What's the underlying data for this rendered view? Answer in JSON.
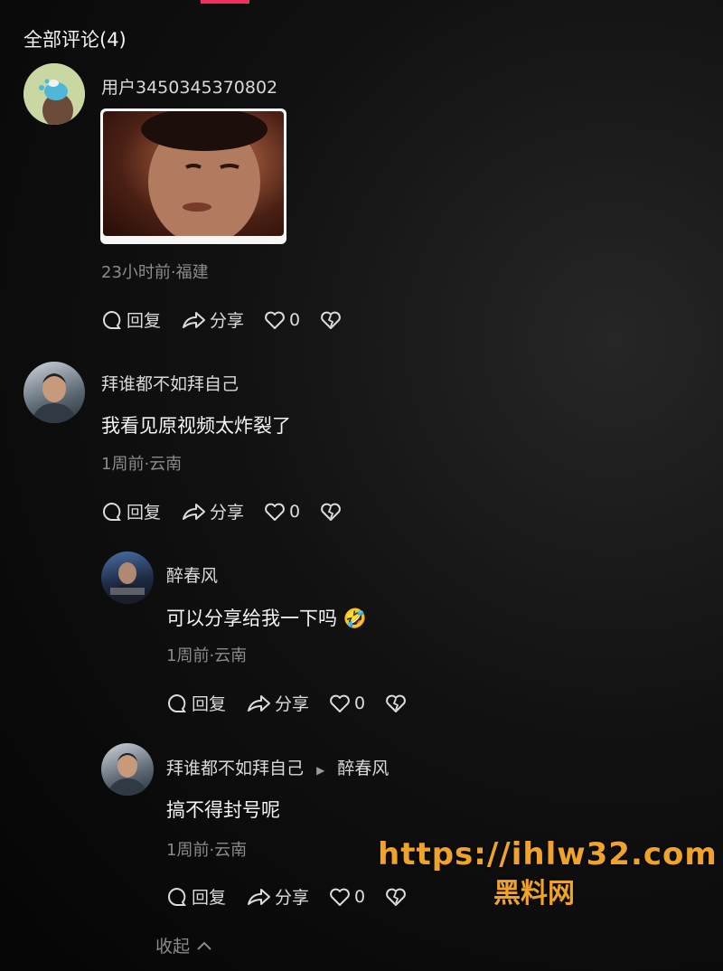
{
  "header": {
    "title": "全部评论(4)"
  },
  "comments": [
    {
      "name": "用户3450345370802",
      "text": "",
      "meta": "23小时前·福建",
      "likes": "0"
    },
    {
      "name": "拜谁都不如拜自己",
      "text": "我看见原视频太炸裂了",
      "meta": "1周前·云南",
      "likes": "0"
    },
    {
      "name": "醉春风",
      "text": "可以分享给我一下吗",
      "emoji": "🤣",
      "meta": "1周前·云南",
      "likes": "0"
    },
    {
      "name": "拜谁都不如拜自己",
      "reply_to": "醉春风",
      "text": "搞不得封号呢",
      "meta": "1周前·云南",
      "likes": "0"
    }
  ],
  "actions": {
    "reply": "回复",
    "share": "分享"
  },
  "collapse": "收起",
  "watermark": {
    "url": "https://ihlw32.com",
    "name": "黑料网"
  },
  "colors": {
    "accent": "#f0305a",
    "watermark": "#f0a32a"
  }
}
